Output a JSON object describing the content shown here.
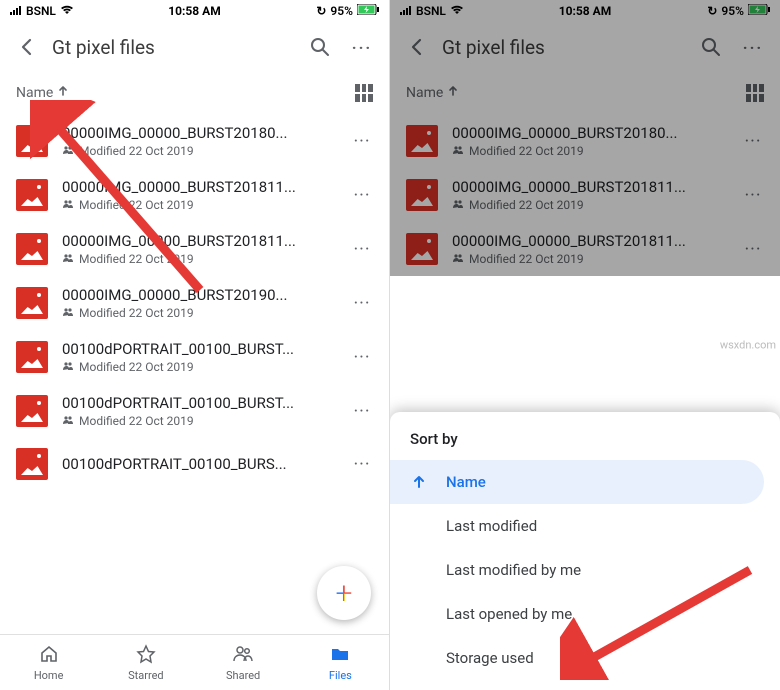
{
  "statusbar": {
    "carrier": "BSNL",
    "time": "10:58 AM",
    "battery": "95%"
  },
  "header": {
    "title": "Gt pixel files"
  },
  "sort": {
    "label": "Name"
  },
  "files": [
    {
      "name": "00000IMG_00000_BURST20180...",
      "meta": "Modified 22 Oct 2019"
    },
    {
      "name": "00000IMG_00000_BURST201811...",
      "meta": "Modified 22 Oct 2019"
    },
    {
      "name": "00000IMG_00000_BURST201811...",
      "meta": "Modified 22 Oct 2019"
    },
    {
      "name": "00000IMG_00000_BURST20190...",
      "meta": "Modified 22 Oct 2019"
    },
    {
      "name": "00100dPORTRAIT_00100_BURST...",
      "meta": "Modified 22 Oct 2019"
    },
    {
      "name": "00100dPORTRAIT_00100_BURST...",
      "meta": "Modified 22 Oct 2019"
    },
    {
      "name": "00100dPORTRAIT_00100_BURS...",
      "meta": ""
    }
  ],
  "files_right": [
    {
      "name": "00000IMG_00000_BURST20180...",
      "meta": "Modified 22 Oct 2019"
    },
    {
      "name": "00000IMG_00000_BURST201811...",
      "meta": "Modified 22 Oct 2019"
    },
    {
      "name": "00000IMG_00000_BURST201811...",
      "meta": "Modified 22 Oct 2019"
    }
  ],
  "nav": {
    "home": "Home",
    "starred": "Starred",
    "shared": "Shared",
    "files": "Files"
  },
  "sheet": {
    "title": "Sort by",
    "items": {
      "name": "Name",
      "last_modified": "Last modified",
      "last_modified_by_me": "Last modified by me",
      "last_opened_by_me": "Last opened by me",
      "storage_used": "Storage used"
    }
  },
  "watermark": "wsxdn.com"
}
